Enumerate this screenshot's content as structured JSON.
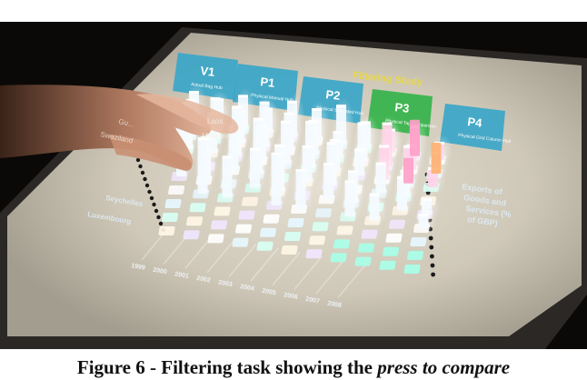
{
  "top_text": "",
  "panels": [
    {
      "code": "V1",
      "sub": "Actual Bag Hub",
      "color": "#3aa6c8"
    },
    {
      "code": "P1",
      "sub": "Physical Manual Hub",
      "color": "#3aa6c8"
    },
    {
      "code": "P2",
      "sub": "Physical Saturated Hub",
      "color": "#3aa6c8"
    },
    {
      "code": "P3",
      "sub": "Physical Tap Comparison",
      "color": "#34b34a"
    },
    {
      "code": "P4",
      "sub": "Physical Grid Column Hub",
      "color": "#3aa6c8"
    }
  ],
  "study_title": "Filtering Study",
  "axis_title": "Exports of Goods and Services (% of GBP)",
  "axis_title_lines": [
    "Exports of",
    "Goods and",
    "Services (%",
    "of GBP)"
  ],
  "country_labels": [
    "Seychelles",
    "Luxembourg"
  ],
  "faint_labels": [
    "Swaziland",
    "Gu...",
    "Laos",
    "Malaysia"
  ],
  "years": [
    "1999",
    "2000",
    "2001",
    "2002",
    "2003",
    "2004",
    "2005",
    "2006",
    "2007",
    "2008"
  ],
  "caption": {
    "prefix": "Figure 6 - Filtering task showing the ",
    "italic": "press to compare"
  },
  "colors": {
    "table": "#c9c2b2",
    "frame": "#2c2a27",
    "study_title": "#e8d84a",
    "axis_text": "#dde8f0",
    "skin": "#d9a58a"
  }
}
